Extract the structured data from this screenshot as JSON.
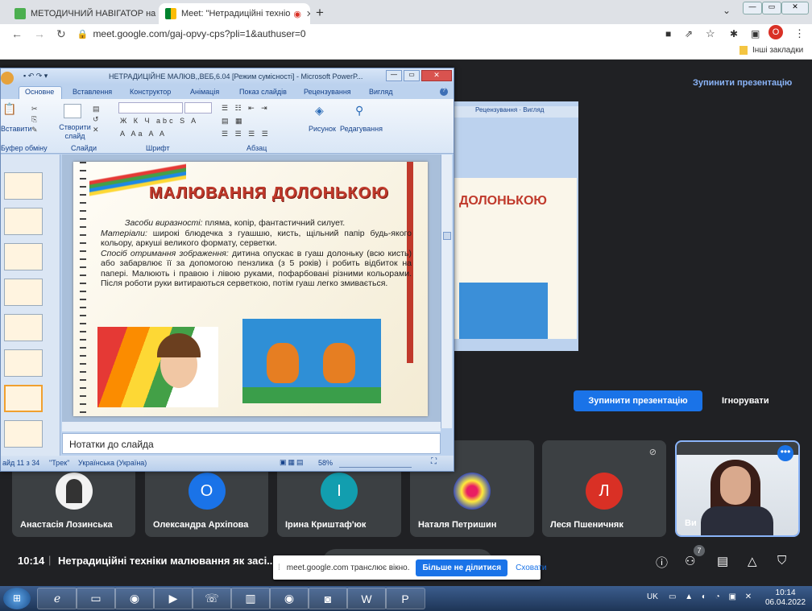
{
  "browser": {
    "tabs": [
      {
        "title": "МЕТОДИЧНИЙ НАВІГАТОР на к"
      },
      {
        "title": "Meet: \"Нетрадиційні техніо"
      }
    ],
    "url": "meet.google.com/gaj-opvy-cps?pli=1&authuser=0",
    "bookmarks_label": "Інші закладки",
    "profile_initial": "О"
  },
  "meet": {
    "stop_presentation_top": "Зупинити презентацію",
    "stop_presentation_btn": "Зупинити презентацію",
    "ignore_btn": "Ігнорувати",
    "time": "10:14",
    "separator": "|",
    "meeting_title": "Нетрадиційні техніки малювання як засі...",
    "participants_count": "7",
    "participants": [
      {
        "name": "Анастасія Лозинська",
        "initial": ""
      },
      {
        "name": "Олександра Архіпова",
        "initial": "О",
        "color": "#1a73e8"
      },
      {
        "name": "Ірина Криштаф'юк",
        "initial": "І",
        "color": "#129eaf"
      },
      {
        "name": "Наталя Петришин",
        "initial": ""
      },
      {
        "name": "Леся Пшеничняк",
        "initial": "Л",
        "color": "#d93025"
      },
      {
        "name": "Ви",
        "initial": ""
      }
    ],
    "share_notice": "meet.google.com транслює вікно.",
    "share_stop": "Більше не ділитися",
    "share_hide": "Сховати"
  },
  "ppt": {
    "title": "НЕТРАДИЦІЙНЕ МАЛЮВ,,ВЕБ,6.04 [Режим сумісності] - Microsoft PowerP...",
    "tabs": [
      "Основне",
      "Вставлення",
      "Конструктор",
      "Анімація",
      "Показ слайдів",
      "Рецензування",
      "Вигляд"
    ],
    "groups": [
      "Буфер обміну",
      "Слайди",
      "Шрифт",
      "Абзац"
    ],
    "buttons": {
      "paste": "Вставити",
      "new_slide": "Створити слайд",
      "picture": "Рисунок",
      "editing": "Редагування"
    },
    "slide": {
      "title": "МАЛЮВАННЯ ДОЛОНЬКОЮ",
      "p1_lead": "Засоби виразності:",
      "p1": " пляма, копір, фантастичний силует.",
      "p2_lead": "Матеріали:",
      "p2": " широкі блюдечка з гуашшю, кисть, щільний папір будь-якого кольору, аркуші великого формату, серветки.",
      "p3_lead": "Спосіб отримання зображення:",
      "p3": " дитина опускає в гуаш долоньку (всю кисть) або забарвлює її за допомогою пензлика (з 5 років) і робить відбиток на папері. Малюють і правою і лівою руками, пофарбовані різними кольорами. Після роботи руки витираються серветкою, потім гуаш легко змивається."
    },
    "notes": "Нотатки до слайда",
    "status": {
      "slide": "айд 11 з 34",
      "theme": "\"Трек\"",
      "lang": "Українська (Україна)",
      "zoom": "58%"
    }
  },
  "taskbar": {
    "lang": "UK",
    "time": "10:14",
    "date": "06.04.2022"
  }
}
